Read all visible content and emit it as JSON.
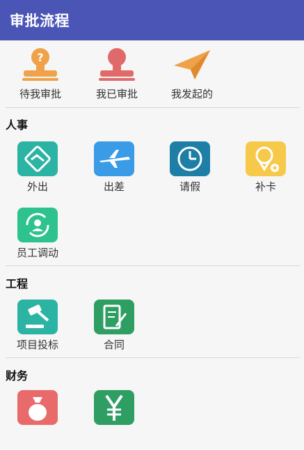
{
  "appbar": {
    "title": "审批流程"
  },
  "top_actions": [
    {
      "label": "待我审批",
      "icon": "pending-approval-stamp-icon",
      "color": "#f0a24a"
    },
    {
      "label": "我已审批",
      "icon": "approved-stamp-icon",
      "color": "#e06a6a"
    },
    {
      "label": "我发起的",
      "icon": "paper-plane-icon",
      "color": "#f0a24a"
    }
  ],
  "sections": {
    "hr": {
      "title": "人事",
      "items": [
        {
          "label": "外出",
          "icon": "handshake-icon",
          "color": "#2bb3a3"
        },
        {
          "label": "出差",
          "icon": "airplane-icon",
          "color": "#3a9be6"
        },
        {
          "label": "请假",
          "icon": "clock-icon",
          "color": "#1e7fa6"
        },
        {
          "label": "补卡",
          "icon": "location-pin-icon",
          "color": "#f6c94a"
        },
        {
          "label": "员工调动",
          "icon": "employee-transfer-icon",
          "color": "#2ec28f"
        }
      ]
    },
    "engineering": {
      "title": "工程",
      "items": [
        {
          "label": "项目投标",
          "icon": "auction-gavel-icon",
          "color": "#2bb3a3"
        },
        {
          "label": "合同",
          "icon": "contract-edit-icon",
          "color": "#2e9e63"
        }
      ]
    },
    "finance": {
      "title": "财务",
      "items": [
        {
          "label": "",
          "icon": "money-bag-icon",
          "color": "#e86a6a"
        },
        {
          "label": "",
          "icon": "yen-icon",
          "color": "#2e9e63"
        }
      ]
    }
  }
}
